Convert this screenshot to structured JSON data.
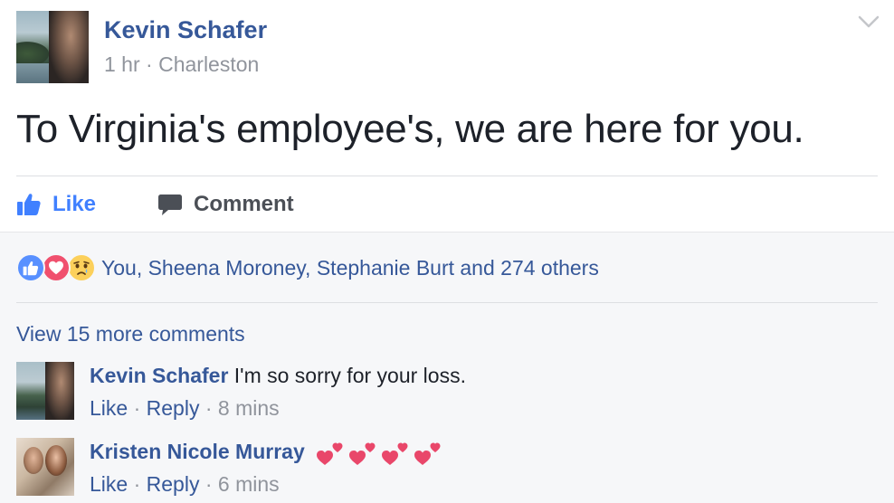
{
  "post": {
    "author": "Kevin Schafer",
    "time": "1 hr",
    "separator": " · ",
    "location": "Charleston",
    "text": "To Virginia's employee's, we are here for you."
  },
  "actions": {
    "like_label": "Like",
    "comment_label": "Comment"
  },
  "reactions": {
    "icons": [
      "like-reaction-icon",
      "love-reaction-icon",
      "sad-reaction-icon"
    ],
    "summary": "You, Sheena Moroney, Stephanie Burt and 274 others"
  },
  "comments_section": {
    "view_more": "View 15 more comments",
    "comments": [
      {
        "author": "Kevin Schafer",
        "text": "I'm so sorry for your loss.",
        "like_label": "Like",
        "reply_label": "Reply",
        "time": "8 mins"
      },
      {
        "author": "Kristen Nicole Murray",
        "text": "",
        "emoji": [
          "two-hearts-icon",
          "two-hearts-icon",
          "two-hearts-icon",
          "two-hearts-icon"
        ],
        "like_label": "Like",
        "reply_label": "Reply",
        "time": "6 mins"
      }
    ],
    "meta_separator": " · "
  },
  "colors": {
    "link_blue": "#365899",
    "like_blue": "#4080ff",
    "meta_gray": "#90949c",
    "love_red": "#f0506e",
    "sad_yellow": "#fcd05b"
  }
}
